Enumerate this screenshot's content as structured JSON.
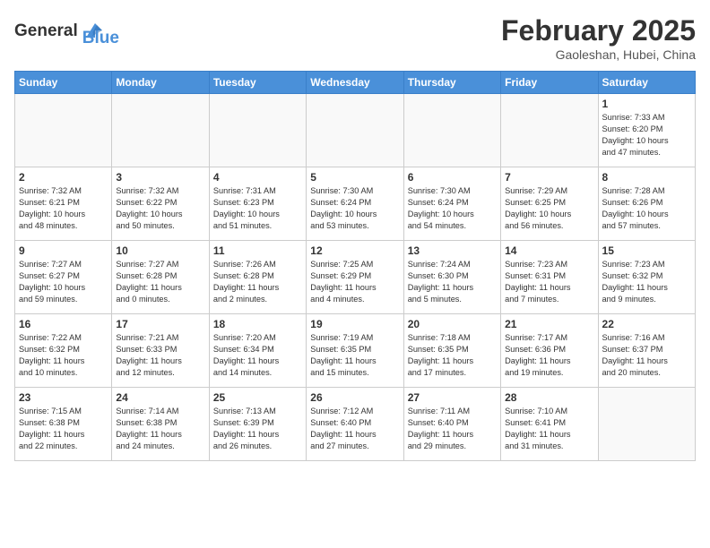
{
  "header": {
    "logo_line1": "General",
    "logo_line2": "Blue",
    "month_title": "February 2025",
    "location": "Gaoleshan, Hubei, China"
  },
  "calendar": {
    "weekdays": [
      "Sunday",
      "Monday",
      "Tuesday",
      "Wednesday",
      "Thursday",
      "Friday",
      "Saturday"
    ],
    "weeks": [
      [
        {
          "day": "",
          "info": ""
        },
        {
          "day": "",
          "info": ""
        },
        {
          "day": "",
          "info": ""
        },
        {
          "day": "",
          "info": ""
        },
        {
          "day": "",
          "info": ""
        },
        {
          "day": "",
          "info": ""
        },
        {
          "day": "1",
          "info": "Sunrise: 7:33 AM\nSunset: 6:20 PM\nDaylight: 10 hours\nand 47 minutes."
        }
      ],
      [
        {
          "day": "2",
          "info": "Sunrise: 7:32 AM\nSunset: 6:21 PM\nDaylight: 10 hours\nand 48 minutes."
        },
        {
          "day": "3",
          "info": "Sunrise: 7:32 AM\nSunset: 6:22 PM\nDaylight: 10 hours\nand 50 minutes."
        },
        {
          "day": "4",
          "info": "Sunrise: 7:31 AM\nSunset: 6:23 PM\nDaylight: 10 hours\nand 51 minutes."
        },
        {
          "day": "5",
          "info": "Sunrise: 7:30 AM\nSunset: 6:24 PM\nDaylight: 10 hours\nand 53 minutes."
        },
        {
          "day": "6",
          "info": "Sunrise: 7:30 AM\nSunset: 6:24 PM\nDaylight: 10 hours\nand 54 minutes."
        },
        {
          "day": "7",
          "info": "Sunrise: 7:29 AM\nSunset: 6:25 PM\nDaylight: 10 hours\nand 56 minutes."
        },
        {
          "day": "8",
          "info": "Sunrise: 7:28 AM\nSunset: 6:26 PM\nDaylight: 10 hours\nand 57 minutes."
        }
      ],
      [
        {
          "day": "9",
          "info": "Sunrise: 7:27 AM\nSunset: 6:27 PM\nDaylight: 10 hours\nand 59 minutes."
        },
        {
          "day": "10",
          "info": "Sunrise: 7:27 AM\nSunset: 6:28 PM\nDaylight: 11 hours\nand 0 minutes."
        },
        {
          "day": "11",
          "info": "Sunrise: 7:26 AM\nSunset: 6:28 PM\nDaylight: 11 hours\nand 2 minutes."
        },
        {
          "day": "12",
          "info": "Sunrise: 7:25 AM\nSunset: 6:29 PM\nDaylight: 11 hours\nand 4 minutes."
        },
        {
          "day": "13",
          "info": "Sunrise: 7:24 AM\nSunset: 6:30 PM\nDaylight: 11 hours\nand 5 minutes."
        },
        {
          "day": "14",
          "info": "Sunrise: 7:23 AM\nSunset: 6:31 PM\nDaylight: 11 hours\nand 7 minutes."
        },
        {
          "day": "15",
          "info": "Sunrise: 7:23 AM\nSunset: 6:32 PM\nDaylight: 11 hours\nand 9 minutes."
        }
      ],
      [
        {
          "day": "16",
          "info": "Sunrise: 7:22 AM\nSunset: 6:32 PM\nDaylight: 11 hours\nand 10 minutes."
        },
        {
          "day": "17",
          "info": "Sunrise: 7:21 AM\nSunset: 6:33 PM\nDaylight: 11 hours\nand 12 minutes."
        },
        {
          "day": "18",
          "info": "Sunrise: 7:20 AM\nSunset: 6:34 PM\nDaylight: 11 hours\nand 14 minutes."
        },
        {
          "day": "19",
          "info": "Sunrise: 7:19 AM\nSunset: 6:35 PM\nDaylight: 11 hours\nand 15 minutes."
        },
        {
          "day": "20",
          "info": "Sunrise: 7:18 AM\nSunset: 6:35 PM\nDaylight: 11 hours\nand 17 minutes."
        },
        {
          "day": "21",
          "info": "Sunrise: 7:17 AM\nSunset: 6:36 PM\nDaylight: 11 hours\nand 19 minutes."
        },
        {
          "day": "22",
          "info": "Sunrise: 7:16 AM\nSunset: 6:37 PM\nDaylight: 11 hours\nand 20 minutes."
        }
      ],
      [
        {
          "day": "23",
          "info": "Sunrise: 7:15 AM\nSunset: 6:38 PM\nDaylight: 11 hours\nand 22 minutes."
        },
        {
          "day": "24",
          "info": "Sunrise: 7:14 AM\nSunset: 6:38 PM\nDaylight: 11 hours\nand 24 minutes."
        },
        {
          "day": "25",
          "info": "Sunrise: 7:13 AM\nSunset: 6:39 PM\nDaylight: 11 hours\nand 26 minutes."
        },
        {
          "day": "26",
          "info": "Sunrise: 7:12 AM\nSunset: 6:40 PM\nDaylight: 11 hours\nand 27 minutes."
        },
        {
          "day": "27",
          "info": "Sunrise: 7:11 AM\nSunset: 6:40 PM\nDaylight: 11 hours\nand 29 minutes."
        },
        {
          "day": "28",
          "info": "Sunrise: 7:10 AM\nSunset: 6:41 PM\nDaylight: 11 hours\nand 31 minutes."
        },
        {
          "day": "",
          "info": ""
        }
      ]
    ]
  }
}
